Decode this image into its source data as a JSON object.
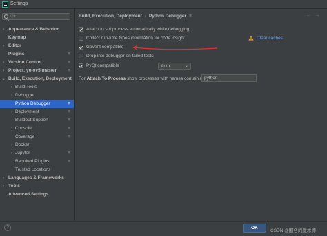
{
  "window": {
    "title": "Settings"
  },
  "search": {
    "placeholder": "Q▾"
  },
  "sidebar": {
    "items": [
      {
        "label": "Appearance & Behavior",
        "arrow": "›",
        "bold": true,
        "gear": false,
        "selected": false,
        "level": 0
      },
      {
        "label": "Keymap",
        "arrow": "",
        "bold": true,
        "gear": false,
        "selected": false,
        "level": 0
      },
      {
        "label": "Editor",
        "arrow": "›",
        "bold": true,
        "gear": false,
        "selected": false,
        "level": 0
      },
      {
        "label": "Plugins",
        "arrow": "",
        "bold": true,
        "gear": true,
        "selected": false,
        "level": 0
      },
      {
        "label": "Version Control",
        "arrow": "›",
        "bold": true,
        "gear": true,
        "selected": false,
        "level": 0
      },
      {
        "label": "Project: yolov5-master",
        "arrow": "›",
        "bold": true,
        "gear": true,
        "selected": false,
        "level": 0
      },
      {
        "label": "Build, Execution, Deployment",
        "arrow": "⌄",
        "bold": true,
        "gear": false,
        "selected": false,
        "level": 0
      },
      {
        "label": "Build Tools",
        "arrow": "›",
        "bold": false,
        "gear": false,
        "selected": false,
        "level": 1
      },
      {
        "label": "Debugger",
        "arrow": "›",
        "bold": false,
        "gear": false,
        "selected": false,
        "level": 1
      },
      {
        "label": "Python Debugger",
        "arrow": "",
        "bold": false,
        "gear": true,
        "selected": true,
        "level": 1
      },
      {
        "label": "Deployment",
        "arrow": "›",
        "bold": false,
        "gear": true,
        "selected": false,
        "level": 1
      },
      {
        "label": "Buildout Support",
        "arrow": "",
        "bold": false,
        "gear": true,
        "selected": false,
        "level": 1
      },
      {
        "label": "Console",
        "arrow": "›",
        "bold": false,
        "gear": true,
        "selected": false,
        "level": 1
      },
      {
        "label": "Coverage",
        "arrow": "",
        "bold": false,
        "gear": true,
        "selected": false,
        "level": 1
      },
      {
        "label": "Docker",
        "arrow": "›",
        "bold": false,
        "gear": false,
        "selected": false,
        "level": 1
      },
      {
        "label": "Jupyter",
        "arrow": "›",
        "bold": false,
        "gear": true,
        "selected": false,
        "level": 1
      },
      {
        "label": "Required Plugins",
        "arrow": "",
        "bold": false,
        "gear": true,
        "selected": false,
        "level": 1
      },
      {
        "label": "Trusted Locations",
        "arrow": "",
        "bold": false,
        "gear": false,
        "selected": false,
        "level": 1
      },
      {
        "label": "Languages & Frameworks",
        "arrow": "›",
        "bold": true,
        "gear": false,
        "selected": false,
        "level": 0
      },
      {
        "label": "Tools",
        "arrow": "›",
        "bold": true,
        "gear": false,
        "selected": false,
        "level": 0
      },
      {
        "label": "Advanced Settings",
        "arrow": "",
        "bold": true,
        "gear": false,
        "selected": false,
        "level": 0
      }
    ]
  },
  "breadcrumb": {
    "parent": "Build, Execution, Deployment",
    "separator": "›",
    "current": "Python Debugger",
    "menu_glyph": "≡",
    "back_glyph": "←",
    "forward_glyph": "→"
  },
  "options": [
    {
      "label": "Attach to subprocess automatically while debugging",
      "checked": true
    },
    {
      "label": "Collect run-time types information for code insight",
      "checked": false
    },
    {
      "label": "Gevent compatible",
      "checked": true
    },
    {
      "label": "Drop into debugger on failed tests",
      "checked": false
    },
    {
      "label": "PyQt compatible",
      "checked": true
    }
  ],
  "clear_caches": {
    "label": "Clear caches"
  },
  "pyqt_combo": {
    "value": "Auto",
    "chevron": "⌄"
  },
  "attach": {
    "prefix": "For ",
    "emphasis": "Attach To Process",
    "suffix": " show processes with names containing:",
    "value": "python"
  },
  "footer": {
    "help": "?",
    "ok_label": "OK",
    "watermark": "CSDN @匿名的魔术师"
  },
  "colors": {
    "background": "#3c3f41",
    "selection": "#2f65ca",
    "link": "#589df6",
    "ok_button": "#365880",
    "annotation": "#e03030"
  }
}
